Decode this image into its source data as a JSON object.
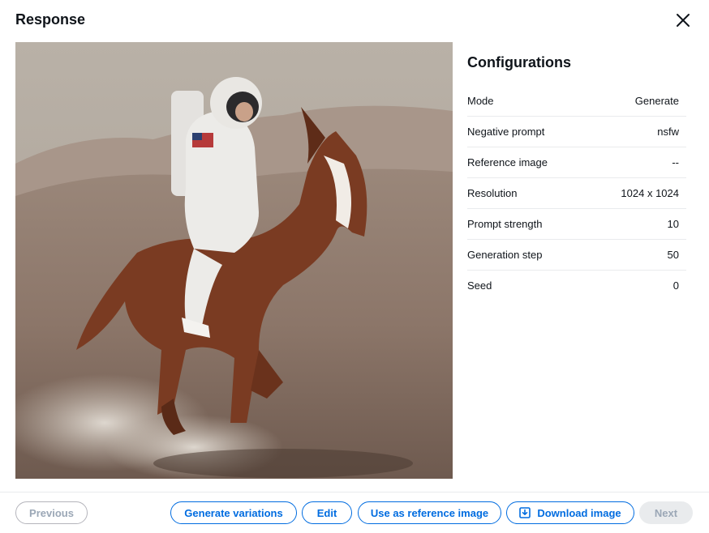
{
  "modal": {
    "title": "Response"
  },
  "configurations": {
    "title": "Configurations",
    "rows": [
      {
        "label": "Mode",
        "value": "Generate"
      },
      {
        "label": "Negative prompt",
        "value": "nsfw"
      },
      {
        "label": "Reference image",
        "value": "--"
      },
      {
        "label": "Resolution",
        "value": "1024 x 1024"
      },
      {
        "label": "Prompt strength",
        "value": "10"
      },
      {
        "label": "Generation step",
        "value": "50"
      },
      {
        "label": "Seed",
        "value": "0"
      }
    ]
  },
  "footer": {
    "previous_label": "Previous",
    "generate_variations_label": "Generate variations",
    "edit_label": "Edit",
    "use_as_reference_label": "Use as reference image",
    "download_label": "Download image",
    "next_label": "Next"
  },
  "icons": {
    "close": "close-icon",
    "download": "download-icon"
  },
  "colors": {
    "accent": "#006ce0",
    "disabled": "#9ba7b6",
    "divider": "#e9ebed"
  }
}
